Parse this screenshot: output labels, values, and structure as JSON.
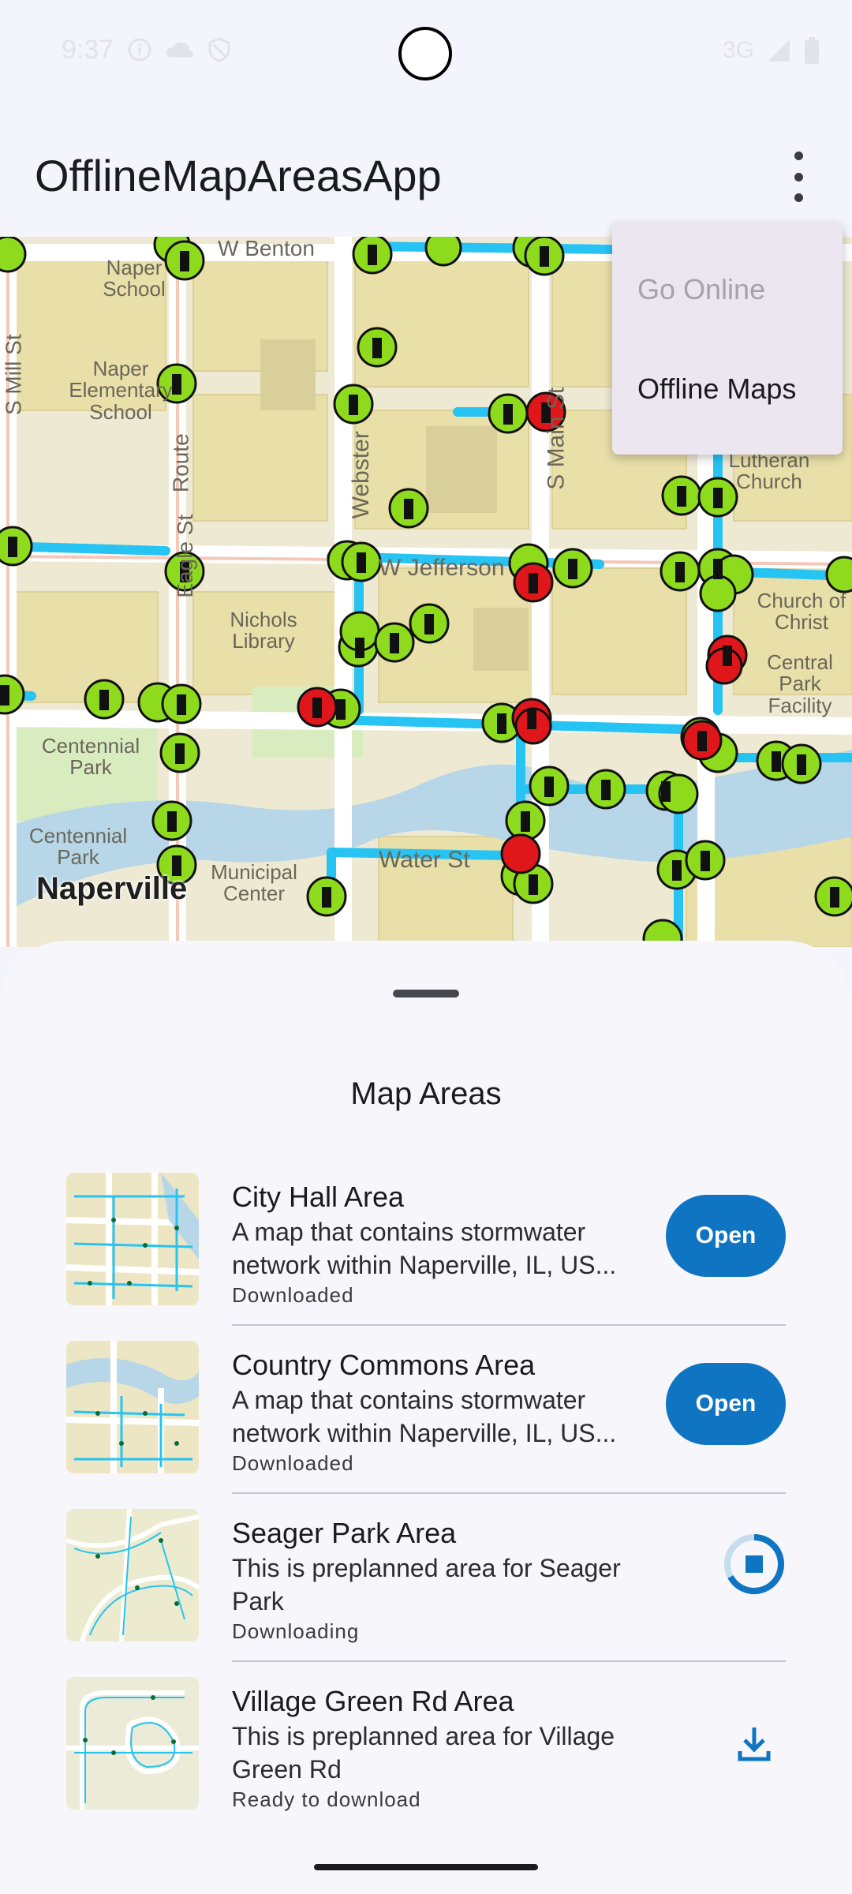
{
  "status_bar": {
    "time": "9:37",
    "network": "3G"
  },
  "app_bar": {
    "title": "OfflineMapAreasApp",
    "overflow_icon": "more-vert-icon"
  },
  "menu": {
    "items": [
      {
        "label": "Go Online",
        "enabled": false
      },
      {
        "label": "Offline Maps",
        "enabled": true
      }
    ]
  },
  "map": {
    "labels": {
      "benton": "W Benton",
      "naper_school": "Naper School",
      "naper_elem": "Naper Elementary School",
      "mill": "S Mill St",
      "eagle": "Eagle St",
      "route": "Route",
      "webster": "Webster",
      "main": "S Main St",
      "jefferson": "W Jefferson",
      "lutheran": "Lutheran Church",
      "church_christ": "Church of Christ",
      "central_park": "Central Park Facility",
      "nichols": "Nichols Library",
      "centennial_park": "Centennial Park",
      "centennial_park2": "Centennial Park",
      "municipal": "Municipal Center",
      "water": "Water St",
      "city": "Naperville"
    },
    "colors": {
      "base": "#eee9d3",
      "block": "#e9dfa9",
      "pipe": "#27c3f2",
      "asset_ok": "#8edb1e",
      "asset_alert": "#e0171a"
    }
  },
  "sheet": {
    "title": "Map Areas",
    "items": [
      {
        "title": "City Hall Area",
        "description": "A map that contains stormwater network within Naperville, IL, US...",
        "status": "Downloaded",
        "action": "Open"
      },
      {
        "title": "Country Commons Area",
        "description": "A map that contains stormwater network within Naperville, IL, US...",
        "status": "Downloaded",
        "action": "Open"
      },
      {
        "title": "Seager Park Area",
        "description": "This is preplanned area for Seager Park",
        "status": "Downloading",
        "action_icon": "stop-progress-icon"
      },
      {
        "title": "Village Green Rd Area",
        "description": "This is preplanned area for Village Green Rd",
        "status": "Ready to download",
        "action_icon": "download-icon"
      }
    ]
  },
  "colors": {
    "accent": "#0f75c2",
    "menu_bg": "#ece6f0",
    "sheet_bg": "#f6f6fb"
  }
}
